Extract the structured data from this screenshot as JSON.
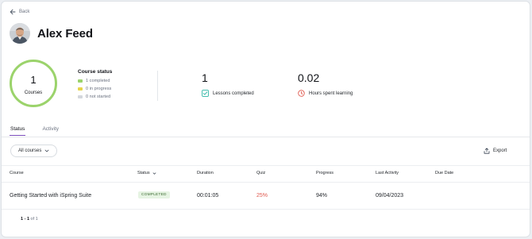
{
  "nav": {
    "back_label": "Back"
  },
  "user": {
    "name": "Alex Feed"
  },
  "courses_summary": {
    "count": "1",
    "label": "Courses",
    "status_title": "Course status",
    "legend": [
      {
        "label": "1 completed",
        "color": "#9bd36b"
      },
      {
        "label": "0 in progress",
        "color": "#e6d44a"
      },
      {
        "label": "0 not started",
        "color": "#d4d7dc"
      }
    ],
    "ring_color": "#9bd36b"
  },
  "stats": {
    "lessons": {
      "value": "1",
      "label": "Lessons completed",
      "icon": "checklist-icon",
      "color": "#2bb5a3"
    },
    "hours": {
      "value": "0.02",
      "label": "Hours spent learning",
      "icon": "clock-icon",
      "color": "#e05a4f"
    }
  },
  "tabs": [
    {
      "label": "Status",
      "active": true
    },
    {
      "label": "Activity",
      "active": false
    }
  ],
  "filters": {
    "course_filter": "All courses"
  },
  "actions": {
    "export_label": "Export"
  },
  "table": {
    "headers": {
      "course": "Course",
      "status": "Status",
      "duration": "Duration",
      "quiz": "Quiz",
      "progress": "Progress",
      "last_activity": "Last Activity",
      "due_date": "Due Date"
    },
    "rows": [
      {
        "course": "Getting Started with iSpring Suite",
        "status": "COMPLETED",
        "duration": "00:01:05",
        "quiz": "25%",
        "progress": "94%",
        "last_activity": "09/04/2023",
        "due_date": ""
      }
    ]
  },
  "pagination": {
    "range": "1 - 1",
    "of_label": "of 1"
  },
  "colors": {
    "accent": "#7b4dbc",
    "quiz_fail": "#e05a4f",
    "completed_badge_bg": "#e6f4e3"
  }
}
